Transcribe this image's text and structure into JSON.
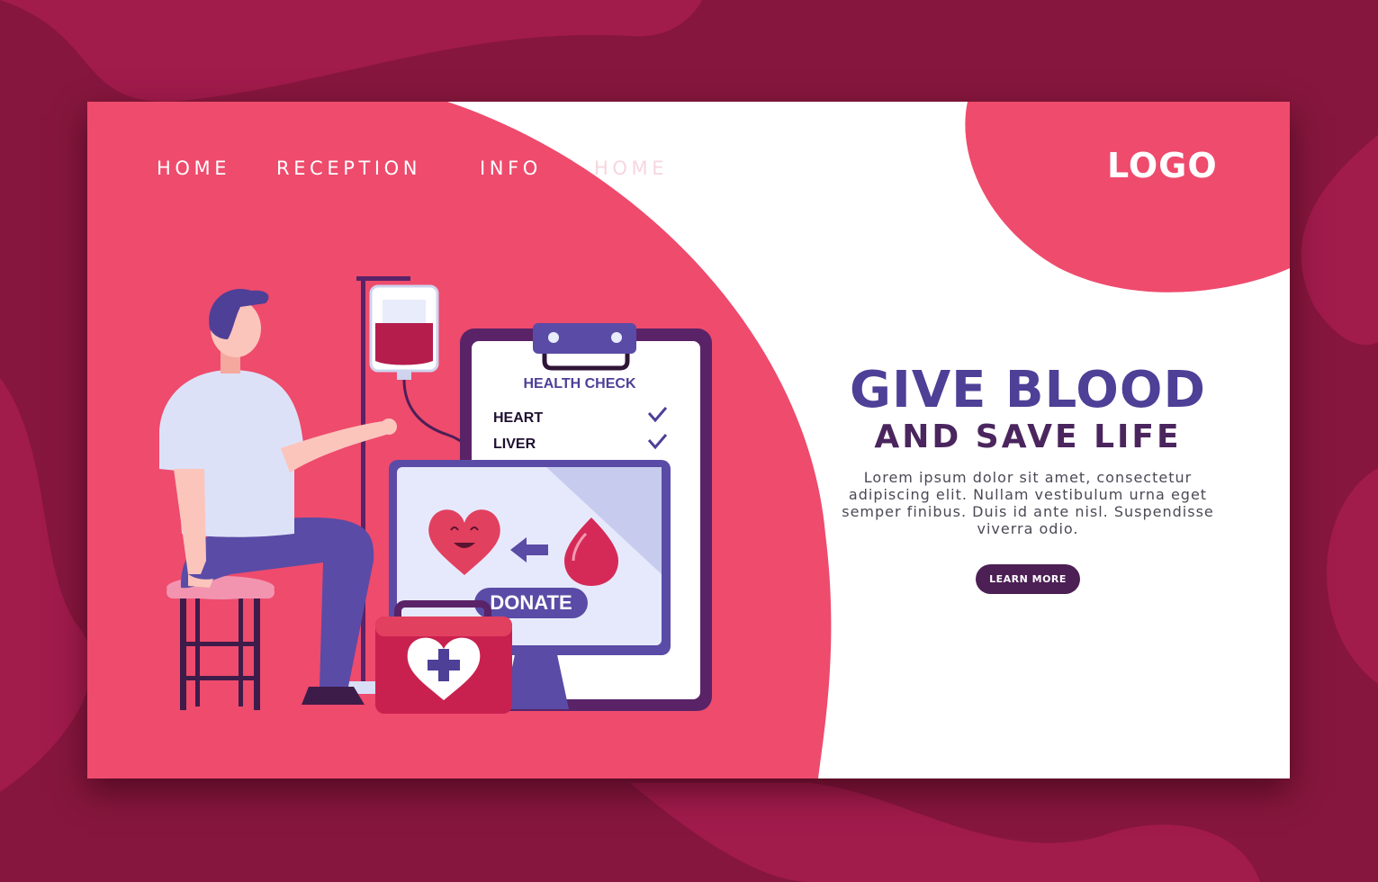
{
  "nav": {
    "items": [
      "HOME",
      "RECEPTION",
      "INFO",
      "HOME"
    ],
    "active_index": 3
  },
  "logo": "LOGO",
  "illustration": {
    "clipboard_title": "HEALTH CHECK",
    "checklist": [
      "HEART",
      "LIVER"
    ],
    "donate_label": "DONATE"
  },
  "hero": {
    "title": "GIVE BLOOD",
    "subtitle": "AND SAVE LIFE",
    "body": "Lorem ipsum dolor sit amet, consectetur adipiscing elit. Nullam vestibulum urna eget semper finibus. Duis id ante nisl. Suspendisse viverra odio.",
    "cta": "LEARN MORE"
  },
  "colors": {
    "outer_background": "#86163d",
    "primary_pink": "#ee4b6d",
    "title_purple": "#4e3f97",
    "dark_purple": "#4c1f55",
    "white": "#ffffff"
  },
  "icons": [
    "blood-bag-icon",
    "clipboard-icon",
    "heart-face-icon",
    "arrow-left-icon",
    "blood-drop-icon",
    "medical-kit-icon",
    "checkmark-icon"
  ]
}
